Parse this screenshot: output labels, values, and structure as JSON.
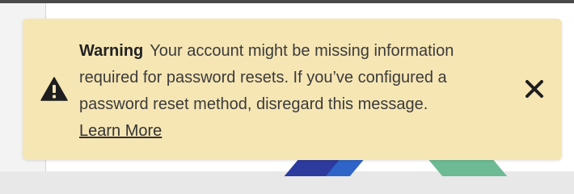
{
  "banner": {
    "icon": "warning-triangle-icon",
    "title": "Warning",
    "message": "Your account might be missing information required for password resets. If you’ve configured a password reset method, disregard this message.",
    "link_label": "Learn More",
    "close_icon": "close-icon",
    "background_color": "#f6e6b4"
  }
}
